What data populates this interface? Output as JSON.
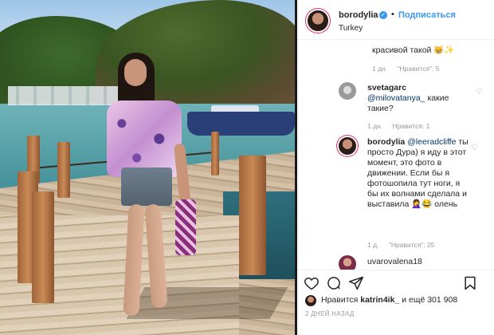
{
  "post": {
    "username": "borodylia",
    "verified_mark": "✓",
    "separator": "•",
    "follow_label": "Подписаться",
    "location": "Turkey"
  },
  "comments": [
    {
      "text": "красивой такой 😸✨",
      "time": "1 дн.",
      "likes": "\"Нравится\": 5"
    },
    {
      "user": "svetagarc",
      "mention": "@milovatanya_",
      "text": " какие такие?",
      "time": "1 дн.",
      "likes": "Нравится: 1"
    },
    {
      "user": "borodylia",
      "mention": "@leeradcliffe",
      "text": " ты просто Дура) я иду в этот момент, это фото в движении. Если бы я фотошопила тут ноги, я бы их волнами сделала и выставила 🤦‍♀️😂 олень",
      "time": "1 д.",
      "likes": "\"Нравится\": 25"
    },
    {
      "user": "uvarovalena18"
    }
  ],
  "actions": {
    "like": "heart-icon",
    "comment": "comment-icon",
    "share": "share-icon",
    "save": "bookmark-icon"
  },
  "likes_summary": {
    "prefix": "Нравится ",
    "user": "katrin4ik_",
    "suffix": " и ещё 301 908"
  },
  "date": "2 ДНЕЙ НАЗАД",
  "colors": {
    "link_blue": "#3897f0",
    "mention_blue": "#003569",
    "meta_gray": "#999999"
  }
}
